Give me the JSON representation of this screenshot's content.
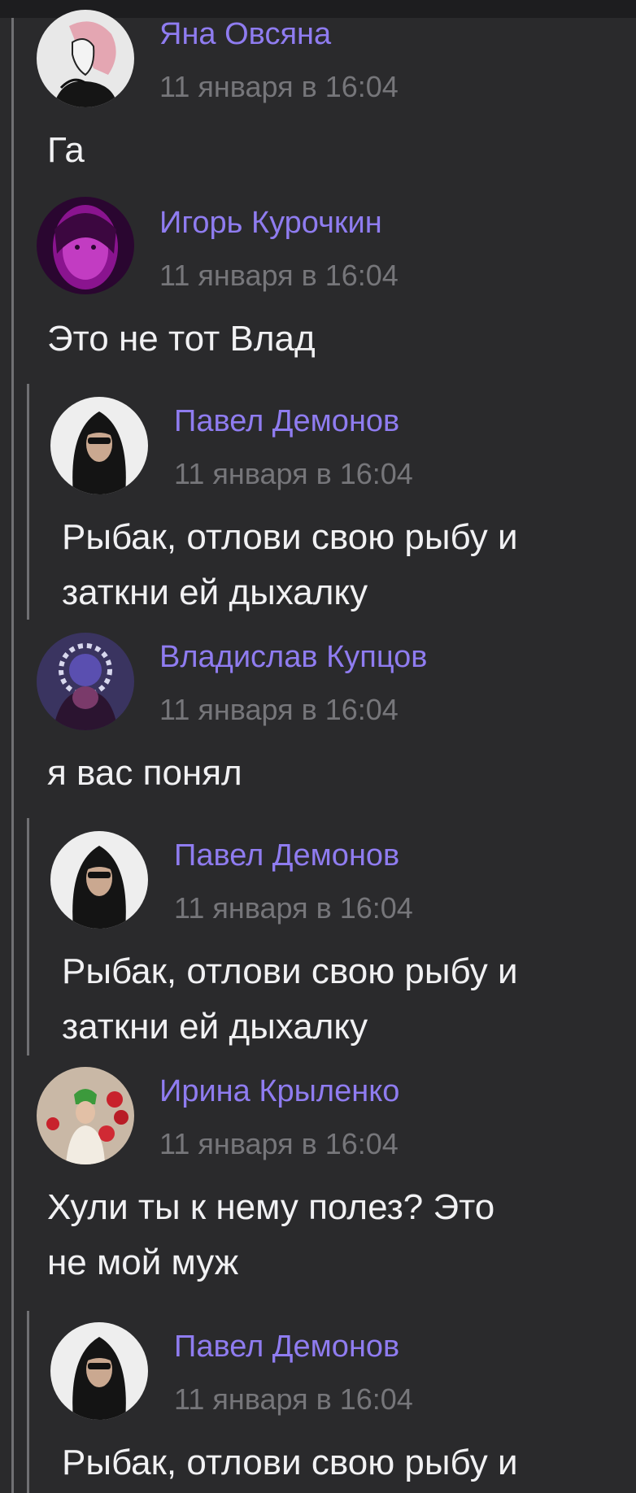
{
  "comments": [
    {
      "author": "Яна Овсяна",
      "time": "11 января в 16:04",
      "lines": [
        "Га"
      ]
    },
    {
      "author": "Игорь Курочкин",
      "time": "11 января в 16:04",
      "lines": [
        "Это не тот Влад"
      ]
    },
    {
      "author": "Павел Демонов",
      "time": "11 января в 16:04",
      "lines": [
        "Рыбак, отлови свою рыбу и",
        "заткни ей дыхалку"
      ]
    },
    {
      "author": "Владислав Купцов",
      "time": "11 января в 16:04",
      "lines": [
        "я вас понял"
      ]
    },
    {
      "author": "Павел Демонов",
      "time": "11 января в 16:04",
      "lines": [
        "Рыбак, отлови свою рыбу и",
        "заткни ей дыхалку"
      ]
    },
    {
      "author": "Ирина Крыленко",
      "time": "11 января в 16:04",
      "lines": [
        "Хули ты к нему полез? Это",
        "не мой муж"
      ]
    },
    {
      "author": "Павел Демонов",
      "time": "11 января в 16:04",
      "lines": [
        "Рыбак, отлови свою рыбу и"
      ]
    }
  ],
  "colors": {
    "background": "#2a2a2c",
    "author": "#8f7cf0",
    "timestamp": "#76767a",
    "message": "#f1f1f3",
    "thread_line": "#707073"
  }
}
